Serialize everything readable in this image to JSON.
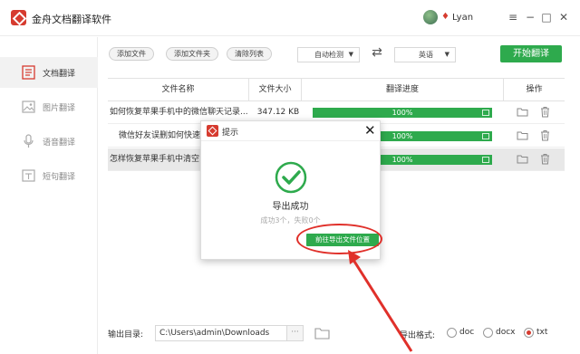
{
  "app": {
    "title": "金舟文档翻译软件",
    "user_name": "Lyan"
  },
  "window_controls": {
    "menu": "≡",
    "minimize": "−",
    "maximize": "□",
    "close": "✕"
  },
  "sidebar": {
    "items": [
      {
        "label": "文档翻译",
        "icon": "document-icon",
        "active": true
      },
      {
        "label": "图片翻译",
        "icon": "image-icon",
        "active": false
      },
      {
        "label": "语音翻译",
        "icon": "microphone-icon",
        "active": false
      },
      {
        "label": "短句翻译",
        "icon": "text-icon",
        "active": false
      }
    ]
  },
  "toolbar": {
    "add_file": "添加文件",
    "add_folder": "添加文件夹",
    "clear_list": "清除列表",
    "source_lang": "自动检测",
    "swap": "⇄",
    "target_lang": "英语",
    "start": "开始翻译"
  },
  "table": {
    "headers": {
      "name": "文件名称",
      "size": "文件大小",
      "progress": "翻译进度",
      "actions": "操作"
    },
    "rows": [
      {
        "name": "如何恢复苹果手机中的微信聊天记录...",
        "size": "347.12 KB",
        "progress_pct": 100,
        "progress_text": "100%"
      },
      {
        "name": "微信好友误删如何快速",
        "size": "",
        "progress_pct": 100,
        "progress_text": "100%"
      },
      {
        "name": "怎样恢复苹果手机中清空",
        "size": "",
        "progress_pct": 100,
        "progress_text": "100%"
      }
    ]
  },
  "footer": {
    "output_label": "输出目录:",
    "output_path": "C:\\Users\\admin\\Downloads",
    "more": "···",
    "format_label": "导出格式:",
    "formats": [
      {
        "label": "doc",
        "checked": false
      },
      {
        "label": "docx",
        "checked": false
      },
      {
        "label": "txt",
        "checked": true
      }
    ]
  },
  "dialog": {
    "title": "提示",
    "close": "✕",
    "message": "导出成功",
    "sub": "成功3个，失败0个",
    "goto_button": "前往导出文件位置"
  },
  "colors": {
    "accent_green": "#2eaa4d",
    "brand_red": "#d63b2f",
    "annotation_red": "#e0302a"
  }
}
